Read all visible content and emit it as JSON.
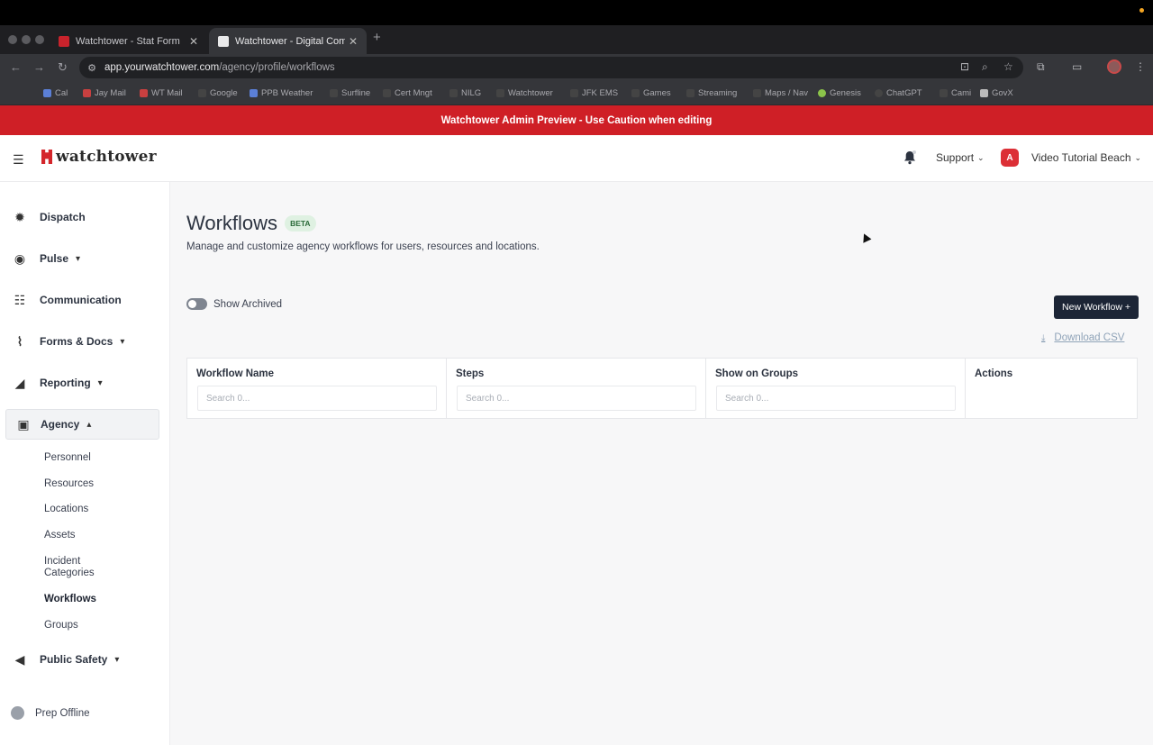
{
  "browser": {
    "tabs": [
      {
        "title": "Watchtower - Stat Form",
        "active": false
      },
      {
        "title": "Watchtower - Digital Comma",
        "active": true
      }
    ],
    "url_host": "app.yourwatchtower.com",
    "url_path": "/agency/profile/workflows",
    "bookmarks": [
      "Cal",
      "Jay Mail",
      "WT Mail",
      "Google",
      "PPB Weather",
      "Surfline",
      "Cert Mngt",
      "NILG",
      "Watchtower",
      "JFK EMS",
      "Games",
      "Streaming",
      "Maps / Nav",
      "Genesis",
      "ChatGPT",
      "Cami",
      "GovX"
    ]
  },
  "banner": {
    "text": "Watchtower Admin Preview - Use Caution when editing"
  },
  "header": {
    "logo_text": "watchtower",
    "support_label": "Support",
    "org_badge": "A",
    "account_name": "Video Tutorial Beach"
  },
  "sidebar": {
    "items": [
      {
        "label": "Dispatch",
        "icon": "dispatch-icon"
      },
      {
        "label": "Pulse",
        "icon": "pulse-icon"
      },
      {
        "label": "Communication",
        "icon": "communication-icon"
      },
      {
        "label": "Forms & Docs",
        "icon": "paperclip-icon"
      },
      {
        "label": "Reporting",
        "icon": "chart-icon"
      },
      {
        "label": "Agency",
        "icon": "person-icon"
      },
      {
        "label": "Public Safety",
        "icon": "megaphone-icon"
      }
    ],
    "agency_sub": [
      "Personnel",
      "Resources",
      "Locations",
      "Assets",
      "Incident Categories",
      "Workflows",
      "Groups"
    ],
    "prep_offline": "Prep Offline"
  },
  "main": {
    "title": "Workflows",
    "badge": "BETA",
    "subtitle": "Manage and customize agency workflows for users, resources and locations.",
    "show_archived_label": "Show Archived",
    "new_button": "New Workflow +",
    "download_csv": "Download CSV",
    "table": {
      "columns": [
        "Workflow Name",
        "Steps",
        "Show on Groups",
        "Actions"
      ],
      "search_placeholder": "Search 0..."
    }
  },
  "colors": {
    "brand_red": "#cf1f26",
    "button_dark": "#1c2536",
    "beta_bg": "#dff1e2"
  }
}
